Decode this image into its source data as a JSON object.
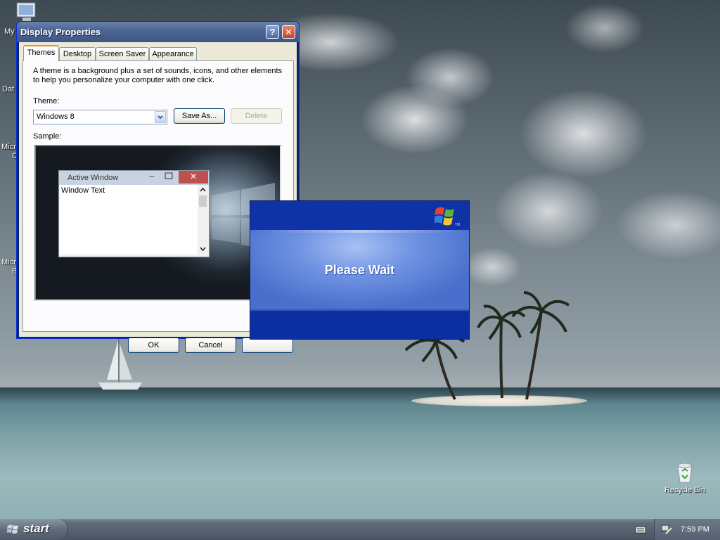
{
  "desktop": {
    "icons": [
      {
        "label_fragment": "My"
      },
      {
        "label_fragment": "Dat"
      },
      {
        "label_fragment": "Micr"
      },
      {
        "label_fragment": "C"
      },
      {
        "label_fragment": "Micr"
      },
      {
        "label_fragment": "B"
      }
    ],
    "recycle_bin_label": "Recycle Bin"
  },
  "display_properties": {
    "title": "Display Properties",
    "help_button": "?",
    "close_button": "✕",
    "tabs": [
      {
        "label": "Themes",
        "active": true
      },
      {
        "label": "Desktop",
        "active": false
      },
      {
        "label": "Screen Saver",
        "active": false
      },
      {
        "label": "Appearance",
        "active": false
      }
    ],
    "description": "A theme is a background plus a set of sounds, icons, and other elements to help you personalize your computer with one click.",
    "theme_label": "Theme:",
    "theme_value": "Windows 8",
    "save_as_label": "Save As...",
    "delete_label": "Delete",
    "sample_label": "Sample:",
    "sample_window": {
      "title": "Active Window",
      "minimize": "–",
      "close": "✕",
      "text": "Window Text"
    },
    "ok_label": "OK",
    "cancel_label": "Cancel",
    "apply_label": ""
  },
  "wait_dialog": {
    "message": "Please Wait",
    "trademark": "TM"
  },
  "taskbar": {
    "start_label": "start",
    "clock": "7:59 PM"
  }
}
